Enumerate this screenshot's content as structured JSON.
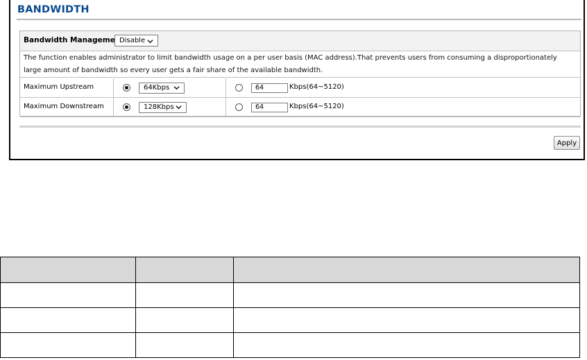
{
  "page": {
    "title": "BANDWIDTH"
  },
  "bandwidth_management": {
    "label": "Bandwidth Management:",
    "selected": "Disable"
  },
  "description": "The function enables administrator to limit bandwidth usage on a per user basis (MAC address).That prevents users from consuming a disproportionately large amount of bandwidth so every user gets a fair share of the available bandwidth.",
  "rows": [
    {
      "label": "Maximum Upstream",
      "preset_selected": true,
      "preset_value": "64Kbps",
      "custom_selected": false,
      "custom_value": "64",
      "custom_range": "Kbps(64~5120)"
    },
    {
      "label": "Maximum Downstream",
      "preset_selected": true,
      "preset_value": "128Kbps",
      "custom_selected": false,
      "custom_value": "64",
      "custom_range": "Kbps(64~5120)"
    }
  ],
  "apply_label": "Apply",
  "doc_table": {
    "header": [
      "",
      "",
      ""
    ],
    "rows": [
      [
        "",
        "",
        ""
      ],
      [
        "",
        "",
        ""
      ],
      [
        "",
        "",
        ""
      ]
    ]
  },
  "icons": {
    "dropdown": "chevron-down-icon"
  },
  "colors": {
    "title": "#0a4a8c",
    "header_bg": "#f2f2f2",
    "table_header_bg": "#d8d8d8"
  }
}
